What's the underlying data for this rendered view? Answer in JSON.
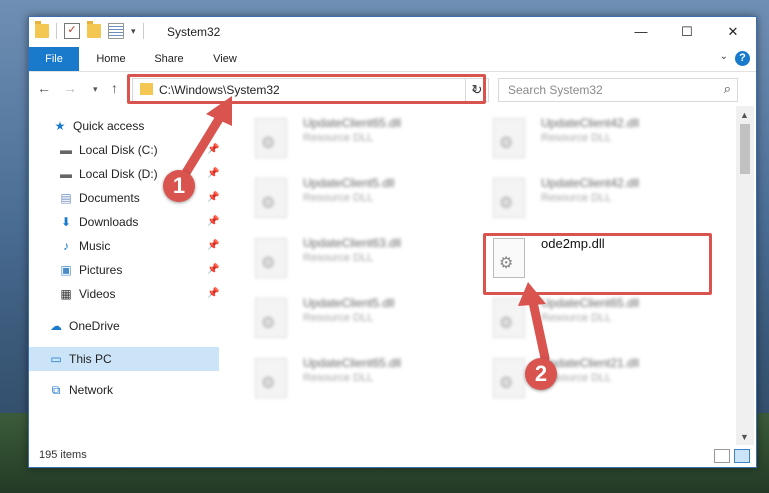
{
  "window": {
    "title": "System32",
    "minimize_glyph": "—",
    "maximize_glyph": "☐",
    "close_glyph": "✕"
  },
  "ribbon": {
    "tabs": [
      {
        "label": "File"
      },
      {
        "label": "Home"
      },
      {
        "label": "Share"
      },
      {
        "label": "View"
      }
    ],
    "help_glyph": "?"
  },
  "navigation": {
    "address": "C:\\Windows\\System32",
    "search_placeholder": "Search System32"
  },
  "sidebar": {
    "quick_access": "Quick access",
    "items": [
      {
        "label": "Local Disk (C:)",
        "icon": "drive-icon"
      },
      {
        "label": "Local Disk (D:)",
        "icon": "drive-icon"
      },
      {
        "label": "Documents",
        "icon": "documents-icon"
      },
      {
        "label": "Downloads",
        "icon": "downloads-icon"
      },
      {
        "label": "Music",
        "icon": "music-icon"
      },
      {
        "label": "Pictures",
        "icon": "pictures-icon"
      },
      {
        "label": "Videos",
        "icon": "videos-icon"
      }
    ],
    "onedrive": "OneDrive",
    "this_pc": "This PC",
    "network": "Network"
  },
  "files": [
    {
      "name": "UpdateClient65.dll",
      "type": "Resource DLL"
    },
    {
      "name": "UpdateClient42.dll",
      "type": "Resource DLL"
    },
    {
      "name": "UpdateClient5.dll",
      "type": "Resource DLL"
    },
    {
      "name": "UpdateClient42.dll",
      "type": "Resource DLL"
    },
    {
      "name": "UpdateClient63.dll",
      "type": "Resource DLL"
    },
    {
      "name": "ode2mp.dll",
      "type": ""
    },
    {
      "name": "UpdateClient5.dll",
      "type": "Resource DLL"
    },
    {
      "name": "UpdateClient65.dll",
      "type": "Resource DLL"
    },
    {
      "name": "UpdateClient65.dll",
      "type": "Resource DLL"
    },
    {
      "name": "UpdateClient21.dll",
      "type": "Resource DLL"
    }
  ],
  "status": {
    "items_count": "195 items"
  },
  "annotations": {
    "step1": "1",
    "step2": "2",
    "color": "#d9534f"
  },
  "colors": {
    "accent": "#1979ca",
    "selection": "#cce4f7"
  }
}
